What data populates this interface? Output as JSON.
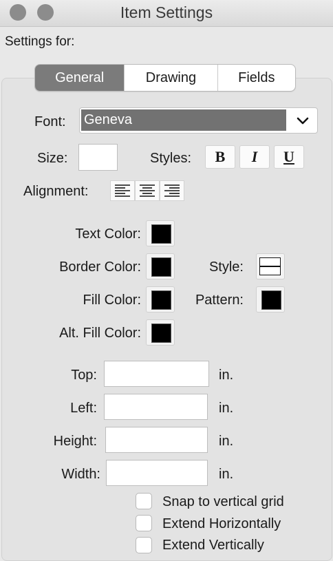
{
  "window": {
    "title": "Item Settings"
  },
  "header": {
    "settings_for": "Settings for:"
  },
  "tabs": [
    {
      "label": "General",
      "active": true
    },
    {
      "label": "Drawing",
      "active": false
    },
    {
      "label": "Fields",
      "active": false
    }
  ],
  "font": {
    "label": "Font:",
    "value": "Geneva"
  },
  "size": {
    "label": "Size:",
    "value": ""
  },
  "styles": {
    "label": "Styles:",
    "bold": "B",
    "italic": "I",
    "underline": "U"
  },
  "alignment": {
    "label": "Alignment:"
  },
  "colors": {
    "text_color": {
      "label": "Text Color:",
      "value": "#000000"
    },
    "border_color": {
      "label": "Border Color:",
      "value": "#000000"
    },
    "fill_color": {
      "label": "Fill Color:",
      "value": "#000000"
    },
    "alt_fill_color": {
      "label": "Alt. Fill Color:",
      "value": "#000000"
    },
    "style": {
      "label": "Style:"
    },
    "pattern": {
      "label": "Pattern:",
      "value": "#000000"
    }
  },
  "position": {
    "top": {
      "label": "Top:",
      "value": "",
      "unit": "in."
    },
    "left": {
      "label": "Left:",
      "value": "",
      "unit": "in."
    },
    "height": {
      "label": "Height:",
      "value": "",
      "unit": "in."
    },
    "width": {
      "label": "Width:",
      "value": "",
      "unit": "in."
    }
  },
  "options": [
    {
      "label": "Snap to vertical grid",
      "checked": false
    },
    {
      "label": "Extend Horizontally",
      "checked": false
    },
    {
      "label": "Extend Vertically",
      "checked": false
    }
  ]
}
